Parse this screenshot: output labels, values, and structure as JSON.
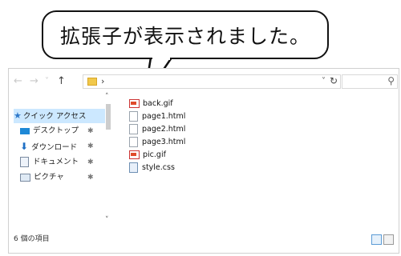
{
  "callout": {
    "text": "拡張子が表示されました。"
  },
  "toolbar": {
    "back": "←",
    "forward": "→",
    "recent": "˅",
    "up": "↑",
    "crumb_chevron": "›",
    "address_dropdown": "˅",
    "refresh": "↻",
    "search_icon": "⚲"
  },
  "nav_pane": {
    "quick_access": "クイック アクセス",
    "items": [
      {
        "label": "デスクトップ",
        "icon": "desktop-icon",
        "pin": "✱"
      },
      {
        "label": "ダウンロード",
        "icon": "download-icon",
        "pin": "✱"
      },
      {
        "label": "ドキュメント",
        "icon": "documents-icon",
        "pin": "✱"
      },
      {
        "label": "ピクチャ",
        "icon": "pictures-icon",
        "pin": "✱"
      }
    ],
    "scroll_up": "˄",
    "scroll_down": "˅"
  },
  "files": [
    {
      "name": "back.gif",
      "type": "gif"
    },
    {
      "name": "page1.html",
      "type": "html"
    },
    {
      "name": "page2.html",
      "type": "html"
    },
    {
      "name": "page3.html",
      "type": "html"
    },
    {
      "name": "pic.gif",
      "type": "gif"
    },
    {
      "name": "style.css",
      "type": "css"
    }
  ],
  "status": {
    "item_count": "6 個の項目"
  },
  "colors": {
    "accent": "#1e88d6",
    "selected_bg": "#cce8ff",
    "folder": "#f1c84b"
  }
}
